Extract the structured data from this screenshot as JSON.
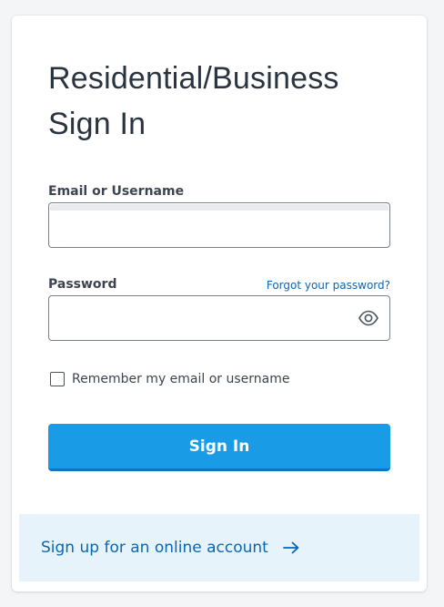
{
  "title": "Residential/Business Sign In",
  "email": {
    "label": "Email or Username",
    "value": "",
    "placeholder": ""
  },
  "password": {
    "label": "Password",
    "forgot_link": "Forgot your password?",
    "value": "",
    "placeholder": "",
    "toggle_icon": "eye-icon"
  },
  "remember": {
    "label": "Remember my email or username",
    "checked": false
  },
  "sign_in_button": "Sign In",
  "signup": {
    "link_text": "Sign up for an online account",
    "icon": "arrow-right-icon"
  },
  "colors": {
    "primary": "#1a9be6",
    "link": "#0b66b1",
    "panel": "#e7f3fb",
    "title": "#2a3440"
  }
}
